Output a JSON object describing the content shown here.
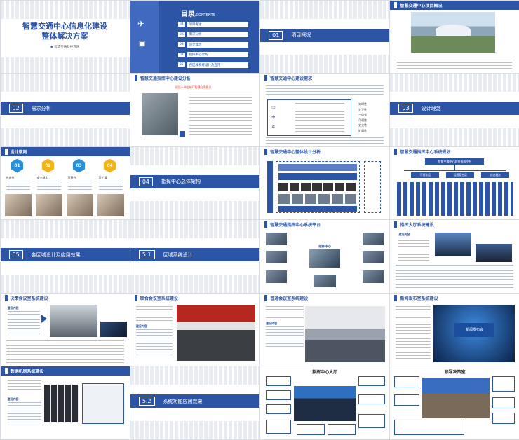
{
  "cover": {
    "title_line1": "智慧交通中心信息化建设",
    "title_line2": "整体解决方案",
    "company": "智慧交通科技方队"
  },
  "toc": {
    "title": "目录",
    "title_en": "/CONTENTS",
    "items": [
      {
        "num": "01",
        "label": "项目概述"
      },
      {
        "num": "02",
        "label": "需求分析"
      },
      {
        "num": "03",
        "label": "设计理念"
      },
      {
        "num": "04",
        "label": "指挥中心架构"
      },
      {
        "num": "05",
        "label": "各区域系统设计及应用"
      }
    ]
  },
  "overview": {
    "num": "01",
    "label": "项目概况"
  },
  "project_overview": {
    "title": "智慧交通中心项目概况"
  },
  "needs": {
    "num": "02",
    "label": "需求分析"
  },
  "cmd_analysis": {
    "title": "智慧交通指挥中心建设分析",
    "subtitle": "建设一种全新IT智慧交通模式"
  },
  "cmd_needs": {
    "title": "智慧交通中心建设需求",
    "side": [
      "实时性",
      "交互性",
      "一体化",
      "可视性",
      "安全性",
      "扩展性"
    ]
  },
  "design": {
    "num": "03",
    "label": "设计理念"
  },
  "principles": {
    "title": "设计原则",
    "items": [
      {
        "num": "01",
        "name": "先进性",
        "color": "#2a8fd6"
      },
      {
        "num": "02",
        "name": "安全稳定",
        "color": "#f2b21c"
      },
      {
        "num": "03",
        "name": "可靠性",
        "color": "#2a8fd6"
      },
      {
        "num": "04",
        "name": "可扩展",
        "color": "#f2b21c"
      }
    ]
  },
  "arch": {
    "num": "04",
    "label": "指挥中心总体架构"
  },
  "overall": {
    "title": "智慧交通中心整体设计分析"
  },
  "planning": {
    "title": "智慧交通指挥中心系统规划",
    "root": "智慧交通中心综合指挥平台",
    "branches": [
      "可视化层",
      "运营管控层",
      "综合服务"
    ]
  },
  "app": {
    "num": "05",
    "label": "各区域设计及应用效果"
  },
  "platform": {
    "title": "智慧交通指挥中心系统平台",
    "center": "指挥中心"
  },
  "hall": {
    "title": "指挥大厅系统建设",
    "label": "建设内容"
  },
  "zone": {
    "num": "5.1",
    "label": "区域系统设计"
  },
  "decision": {
    "title": "决策会议室系统建设",
    "label": "建设内容"
  },
  "joint": {
    "title": "联合会议室系统建设",
    "label": "建设内容"
  },
  "general": {
    "title": "普通会议室系统建设",
    "label": "建设内容"
  },
  "press": {
    "title": "新闻发布室系统建设",
    "screen_text": "新闻发布会"
  },
  "datacenter": {
    "title": "数据机房系统建设",
    "label": "建设内容"
  },
  "func": {
    "num": "5.2",
    "label": "系统功能应用效果"
  },
  "hall_effect": {
    "title": "指挥中心大厅"
  },
  "leader": {
    "title": "领导决策室"
  }
}
